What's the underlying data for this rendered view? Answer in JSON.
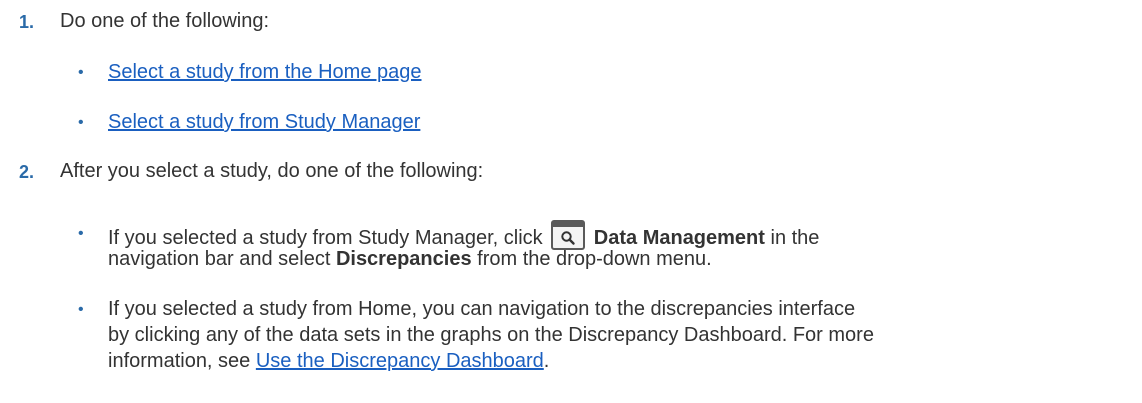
{
  "steps": [
    {
      "number": "1.",
      "text": "Do one of the following:",
      "items": [
        {
          "link": "Select a study from the Home page"
        },
        {
          "link": "Select a study from Study Manager"
        }
      ]
    },
    {
      "number": "2.",
      "text": "After you select a study, do one of the following:",
      "items": [
        {
          "line1_pre": "If you selected a study from Study Manager, click",
          "line1_bold": "Data Management",
          "line1_post": "in the",
          "line2_pre": "navigation bar and select",
          "line2_bold": "Discrepancies",
          "line2_post": "from the drop-down menu.",
          "icon": "search-icon"
        },
        {
          "line1": "If you selected a study from Home, you can navigation to the discrepancies interface",
          "line2": "by clicking any of the data sets in the graphs on the Discrepancy Dashboard. For more",
          "line3_pre": "information, see",
          "line3_link": "Use the Discrepancy Dashboard",
          "line3_post": "."
        }
      ]
    }
  ]
}
